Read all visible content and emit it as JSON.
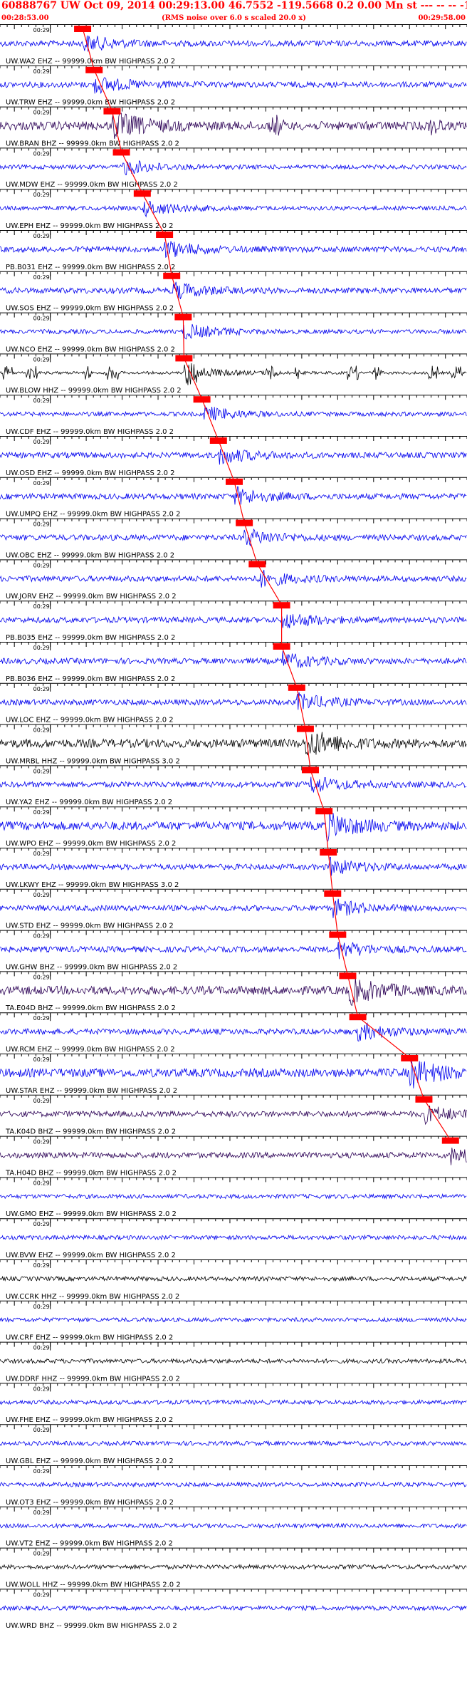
{
  "header": {
    "title": "60888767 UW Oct 09, 2014 00:29:13.00   46.7552 -119.5668  0.2 0.00 Mn st --- -- --  -1",
    "start_time": "00:28:53.00",
    "rms_note": "(RMS noise over 6.0 s scaled 20.0 x)",
    "end_time": "00:29:58.00"
  },
  "colors": {
    "title": "#ff0000",
    "trace_blue": "#0000ee",
    "trace_black": "#000000",
    "trace_purple": "#2b0055",
    "pick_box": "#ff0000",
    "pick_line": "#ff0000"
  },
  "chart_data": {
    "type": "seismogram-record-section",
    "time_range_s": [
      0,
      65
    ],
    "minute_marker_label": "00:29",
    "minute_marker_time_s": 7,
    "pick_line_color": "red",
    "traces": [
      {
        "name": "UW.WA2 EHZ -- 99999.0km BW  HIGHPASS  2.0  2",
        "color": "blue",
        "pick_s": 11.5,
        "amplitude": "medium"
      },
      {
        "name": "UW.TRW EHZ -- 99999.0km BW  HIGHPASS  2.0  2",
        "color": "blue",
        "pick_s": 13.1,
        "amplitude": "medium"
      },
      {
        "name": "UW.BRAN BHZ -- 99999.0km BW  HIGHPASS  2.0  2",
        "color": "purple",
        "pick_s": 15.6,
        "amplitude": "high",
        "events_s": [
          38.5,
          60.5
        ]
      },
      {
        "name": "UW.MDW EHZ -- 99999.0km BW  HIGHPASS  2.0  2",
        "color": "blue",
        "pick_s": 16.9,
        "amplitude": "low"
      },
      {
        "name": "UW.EPH EHZ -- 99999.0km BW  HIGHPASS  2.0  2",
        "color": "blue",
        "pick_s": 19.8,
        "amplitude": "low"
      },
      {
        "name": "PB.B031 EHZ -- 99999.0km BW  HIGHPASS  2.0  2",
        "color": "blue",
        "pick_s": 22.9,
        "amplitude": "medium"
      },
      {
        "name": "UW.SOS EHZ -- 99999.0km BW  HIGHPASS  2.0  2",
        "color": "blue",
        "pick_s": 23.9,
        "amplitude": "medium"
      },
      {
        "name": "UW.NCO EHZ -- 99999.0km BW  HIGHPASS  2.0  2",
        "color": "blue",
        "pick_s": 25.5,
        "amplitude": "low"
      },
      {
        "name": "UW.BLOW HHZ -- 99999.0km BW  HIGHPASS  2.0  2",
        "color": "black",
        "pick_s": 25.6,
        "amplitude": "bursty"
      },
      {
        "name": "UW.CDF EHZ -- 99999.0km BW  HIGHPASS  2.0  2",
        "color": "blue",
        "pick_s": 28.1,
        "amplitude": "low"
      },
      {
        "name": "UW.OSD EHZ -- 99999.0km BW  HIGHPASS  2.0  2",
        "color": "blue",
        "pick_s": 30.4,
        "amplitude": "medium"
      },
      {
        "name": "UW.UMPQ EHZ -- 99999.0km BW  HIGHPASS  2.0  2",
        "color": "blue",
        "pick_s": 32.6,
        "amplitude": "medium"
      },
      {
        "name": "UW.OBC EHZ -- 99999.0km BW  HIGHPASS  2.0  2",
        "color": "blue",
        "pick_s": 34.0,
        "amplitude": "medium"
      },
      {
        "name": "UW.JORV EHZ -- 99999.0km BW  HIGHPASS  2.0  2",
        "color": "blue",
        "pick_s": 35.8,
        "amplitude": "medium"
      },
      {
        "name": "PB.B035 EHZ -- 99999.0km BW  HIGHPASS  2.0  2",
        "color": "blue",
        "pick_s": 39.2,
        "amplitude": "medium"
      },
      {
        "name": "PB.B036 EHZ -- 99999.0km BW  HIGHPASS  2.0  2",
        "color": "blue",
        "pick_s": 39.2,
        "amplitude": "medium"
      },
      {
        "name": "UW.LOC EHZ -- 99999.0km BW  HIGHPASS  2.0  2",
        "color": "blue",
        "pick_s": 41.3,
        "amplitude": "medium"
      },
      {
        "name": "UW.MRBL HHZ -- 99999.0km BW  HIGHPASS  3.0  2",
        "color": "black",
        "pick_s": 42.5,
        "amplitude": "high"
      },
      {
        "name": "UW.YA2 EHZ -- 99999.0km BW  HIGHPASS  2.0  2",
        "color": "blue",
        "pick_s": 43.2,
        "amplitude": "medium"
      },
      {
        "name": "UW.WPO EHZ -- 99999.0km BW  HIGHPASS  2.0  2",
        "color": "blue",
        "pick_s": 45.1,
        "amplitude": "high"
      },
      {
        "name": "UW.LKWY EHZ -- 99999.0km BW  HIGHPASS  3.0  2",
        "color": "blue",
        "pick_s": 45.7,
        "amplitude": "medium"
      },
      {
        "name": "UW.STD EHZ -- 99999.0km BW  HIGHPASS  2.0  2",
        "color": "blue",
        "pick_s": 46.3,
        "amplitude": "medium"
      },
      {
        "name": "UW.GHW BHZ -- 99999.0km BW  HIGHPASS  2.0  2",
        "color": "blue",
        "pick_s": 47.0,
        "amplitude": "medium"
      },
      {
        "name": "TA.E04D BHZ -- 99999.0km BW  HIGHPASS  2.0  2",
        "color": "purple",
        "pick_s": 48.4,
        "amplitude": "high"
      },
      {
        "name": "UW.RCM EHZ -- 99999.0km BW  HIGHPASS  2.0  2",
        "color": "blue",
        "pick_s": 49.8,
        "amplitude": "medium"
      },
      {
        "name": "UW.STAR EHZ -- 99999.0km BW  HIGHPASS  2.0  2",
        "color": "blue",
        "pick_s": 57.0,
        "amplitude": "high"
      },
      {
        "name": "TA.K04D BHZ -- 99999.0km BW  HIGHPASS  2.0  2",
        "color": "purple",
        "pick_s": 59.0,
        "amplitude": "medium"
      },
      {
        "name": "TA.H04D BHZ -- 99999.0km BW  HIGHPASS  2.0  2",
        "color": "purple",
        "pick_s": 62.7,
        "amplitude": "medium"
      },
      {
        "name": "UW.GMO EHZ -- 99999.0km BW  HIGHPASS  2.0  2",
        "color": "blue",
        "amplitude": "low"
      },
      {
        "name": "UW.BVW EHZ -- 99999.0km BW  HIGHPASS  2.0  2",
        "color": "blue",
        "amplitude": "low"
      },
      {
        "name": "UW.CCRK HHZ -- 99999.0km BW  HIGHPASS  2.0  2",
        "color": "black",
        "amplitude": "low"
      },
      {
        "name": "UW.CRF EHZ -- 99999.0km BW  HIGHPASS  2.0  2",
        "color": "blue",
        "amplitude": "low"
      },
      {
        "name": "UW.DDRF HHZ -- 99999.0km BW  HIGHPASS  2.0  2",
        "color": "black",
        "amplitude": "low"
      },
      {
        "name": "UW.FHE EHZ -- 99999.0km BW  HIGHPASS  2.0  2",
        "color": "blue",
        "amplitude": "low"
      },
      {
        "name": "UW.GBL EHZ -- 99999.0km BW  HIGHPASS  2.0  2",
        "color": "blue",
        "amplitude": "low"
      },
      {
        "name": "UW.OT3 EHZ -- 99999.0km BW  HIGHPASS  2.0  2",
        "color": "blue",
        "amplitude": "low"
      },
      {
        "name": "UW.VT2 EHZ -- 99999.0km BW  HIGHPASS  2.0  2",
        "color": "blue",
        "amplitude": "low"
      },
      {
        "name": "UW.WOLL HHZ -- 99999.0km BW  HIGHPASS  2.0  2",
        "color": "black",
        "amplitude": "low"
      },
      {
        "name": "UW.WRD BHZ -- 99999.0km BW  HIGHPASS  2.0  2",
        "color": "blue",
        "amplitude": "low"
      }
    ]
  }
}
